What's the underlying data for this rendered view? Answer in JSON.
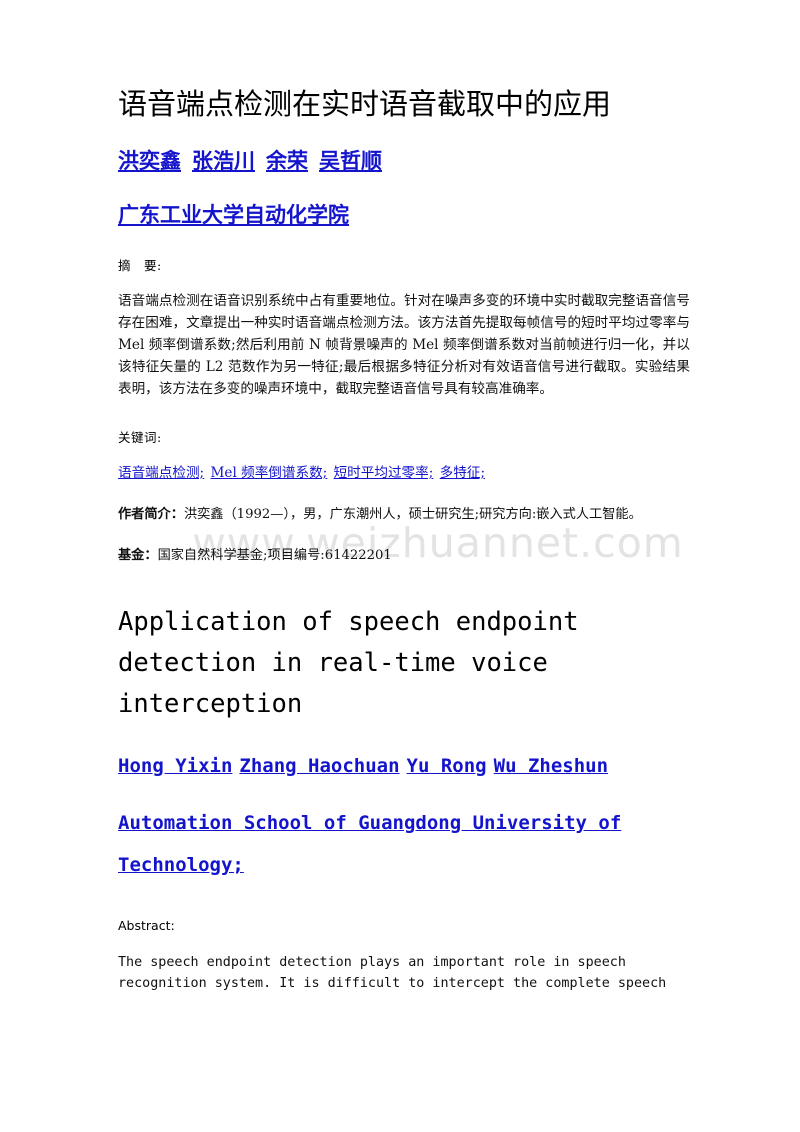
{
  "watermark": {
    "text": "www.weizhuannet.com",
    "color": "#e3e3e3"
  },
  "colors": {
    "link": "#1414cc",
    "text": "#111111",
    "background": "#ffffff"
  },
  "chinese": {
    "title": "语音端点检测在实时语音截取中的应用",
    "authors": [
      "洪奕鑫",
      "张浩川",
      "余荣",
      "吴哲顺"
    ],
    "affiliation": "广东工业大学自动化学院",
    "abstract_label_part1": "摘",
    "abstract_label_part2": "要:",
    "abstract_text": "语音端点检测在语音识别系统中占有重要地位。针对在噪声多变的环境中实时截取完整语音信号存在困难，文章提出一种实时语音端点检测方法。该方法首先提取每帧信号的短时平均过零率与 Mel 频率倒谱系数;然后利用前 N 帧背景噪声的 Mel 频率倒谱系数对当前帧进行归一化，并以该特征矢量的 L2 范数作为另一特征;最后根据多特征分析对有效语音信号进行截取。实验结果表明，该方法在多变的噪声环境中，截取完整语音信号具有较高准确率。",
    "keywords_label": "关键词:",
    "keywords": [
      "语音端点检测;",
      "Mel 频率倒谱系数;",
      "短时平均过零率;",
      "多特征;"
    ],
    "bio_label": "作者简介：",
    "bio_text": "洪奕鑫（1992—），男，广东潮州人，硕士研究生;研究方向:嵌入式人工智能。",
    "fund_label": "基金：",
    "fund_text": "国家自然科学基金;项目编号:61422201"
  },
  "english": {
    "title": "Application of speech endpoint detection in real-time voice interception",
    "authors": [
      "Hong Yixin",
      "Zhang Haochuan",
      "Yu Rong",
      "Wu Zheshun"
    ],
    "affiliation": "Automation School of Guangdong University of Technology;",
    "abstract_label": "Abstract:",
    "abstract_text": "The speech endpoint detection plays an important role in speech recognition system. It is difficult to intercept the complete speech"
  }
}
